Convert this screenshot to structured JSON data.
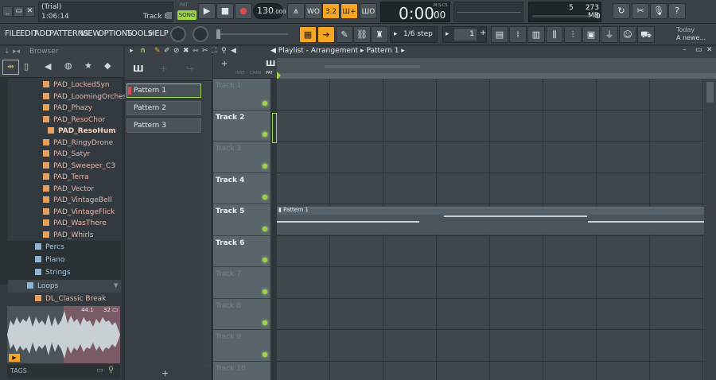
{
  "window": {
    "title": "(Trial)",
    "time_display": "1:06:14",
    "hint_target": "Track 8",
    "minimize": "_",
    "restore": "▭",
    "close": "✕"
  },
  "transport": {
    "pat_label": "PAT",
    "song_label": "SONG",
    "tempo": "130",
    "tempo_fraction": ".000",
    "time": "0:00",
    "time_fraction": ":00",
    "time_format": "M:S:CS",
    "cpu_label": "5",
    "ram_label": "273 MB",
    "poly_label": "0",
    "news_label": "Today",
    "news_text": "A newe..."
  },
  "menu": {
    "items": [
      "FILE",
      "EDIT",
      "ADD",
      "PATTERNS",
      "VIEW",
      "OPTIONS",
      "TOOLS",
      "HELP"
    ],
    "snap_label": "1/6 step",
    "pattern_number": "1"
  },
  "browser": {
    "title": "Browser",
    "items": [
      {
        "label": "PAD_LockedSyn",
        "kind": "file",
        "indent": 1
      },
      {
        "label": "PAD_LoomingOrchestra",
        "kind": "file",
        "indent": 1
      },
      {
        "label": "PAD_Phazy",
        "kind": "file",
        "indent": 1
      },
      {
        "label": "PAD_ResoChor",
        "kind": "file",
        "indent": 1
      },
      {
        "label": "PAD_ResoHum",
        "kind": "file-selected",
        "indent": 2
      },
      {
        "label": "PAD_RingyDrone",
        "kind": "file",
        "indent": 1
      },
      {
        "label": "PAD_Satyr",
        "kind": "file",
        "indent": 1
      },
      {
        "label": "PAD_Sweeper_C3",
        "kind": "file",
        "indent": 1
      },
      {
        "label": "PAD_Terra",
        "kind": "file",
        "indent": 1
      },
      {
        "label": "PAD_Vector",
        "kind": "file",
        "indent": 1
      },
      {
        "label": "PAD_VintageBell",
        "kind": "file",
        "indent": 1
      },
      {
        "label": "PAD_VintageFlick",
        "kind": "file",
        "indent": 1
      },
      {
        "label": "PAD_WasThere",
        "kind": "file",
        "indent": 1
      },
      {
        "label": "PAD_Whirls",
        "kind": "file",
        "indent": 1
      },
      {
        "label": "Percs",
        "kind": "folder",
        "indent": 0
      },
      {
        "label": "Piano",
        "kind": "folder",
        "indent": 0
      },
      {
        "label": "Strings",
        "kind": "folder",
        "indent": 0
      },
      {
        "label": "Loops",
        "kind": "folder-open",
        "indent": -1
      },
      {
        "label": "DL_Classic Break",
        "kind": "file",
        "indent": 0
      }
    ],
    "sample_info": "44.1",
    "sample_bits": "32",
    "tags_label": "TAGS"
  },
  "picker": {
    "patterns": [
      "Pattern 1",
      "Pattern 2",
      "Pattern 3"
    ]
  },
  "playlist": {
    "title": "Playlist - Arrangement",
    "current_pattern": "Pattern 1",
    "tracks": [
      {
        "name": "Track 1",
        "style": "dim"
      },
      {
        "name": "Track 2",
        "style": "bold"
      },
      {
        "name": "Track 3",
        "style": "dim"
      },
      {
        "name": "Track 4",
        "style": "bold"
      },
      {
        "name": "Track 5",
        "style": "bold"
      },
      {
        "name": "Track 6",
        "style": "bold"
      },
      {
        "name": "Track 7",
        "style": "dim"
      },
      {
        "name": "Track 8",
        "style": "dim"
      },
      {
        "name": "Track 9",
        "style": "dim"
      },
      {
        "name": "Track 10",
        "style": "dim"
      }
    ],
    "clip_label": "Pattern 1",
    "tab_labels": [
      "INST",
      "CHAN",
      "PAT"
    ]
  },
  "colors": {
    "accent": "#f6a623",
    "led": "#9ed64a"
  }
}
